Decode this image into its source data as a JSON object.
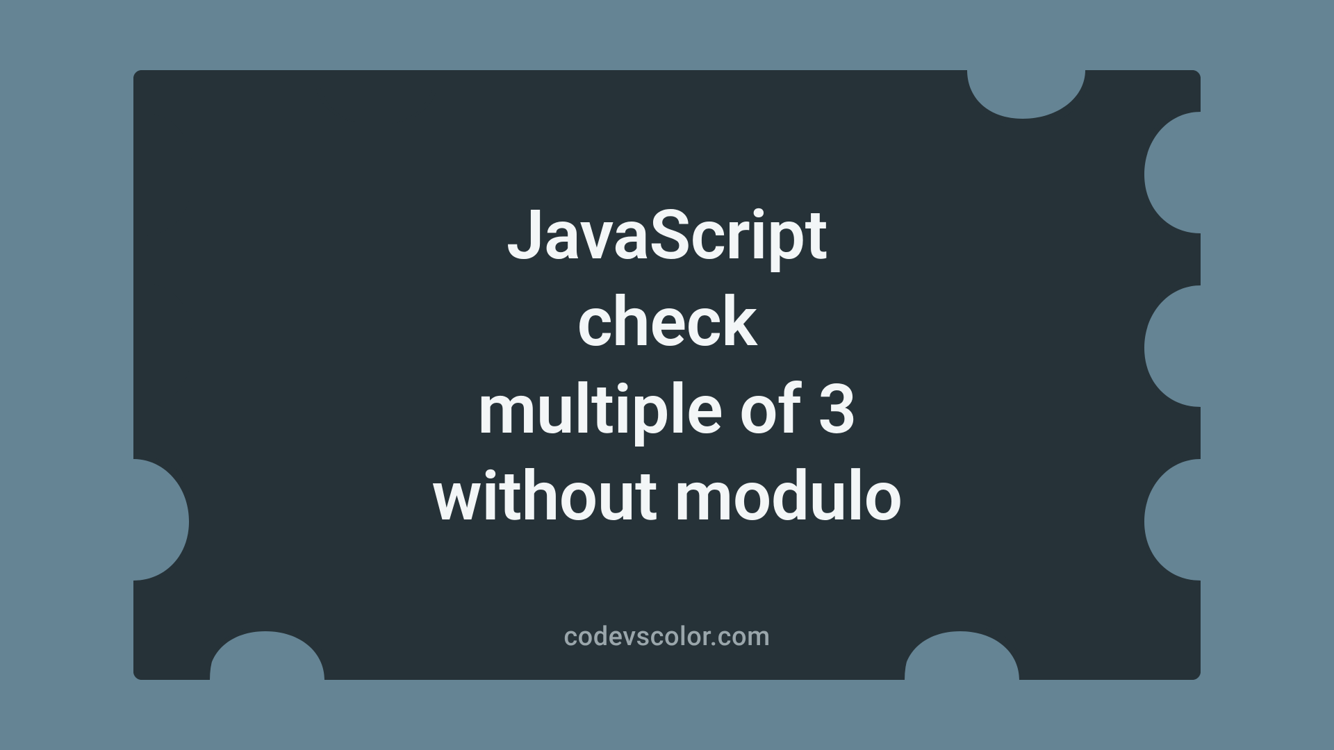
{
  "title_lines": [
    "JavaScript",
    "check",
    "multiple of 3",
    "without modulo"
  ],
  "footer": "codevscolor.com",
  "colors": {
    "bg": "#658494",
    "shape": "#263238",
    "title": "#f3f6f7",
    "footer": "#9aa6ab"
  }
}
